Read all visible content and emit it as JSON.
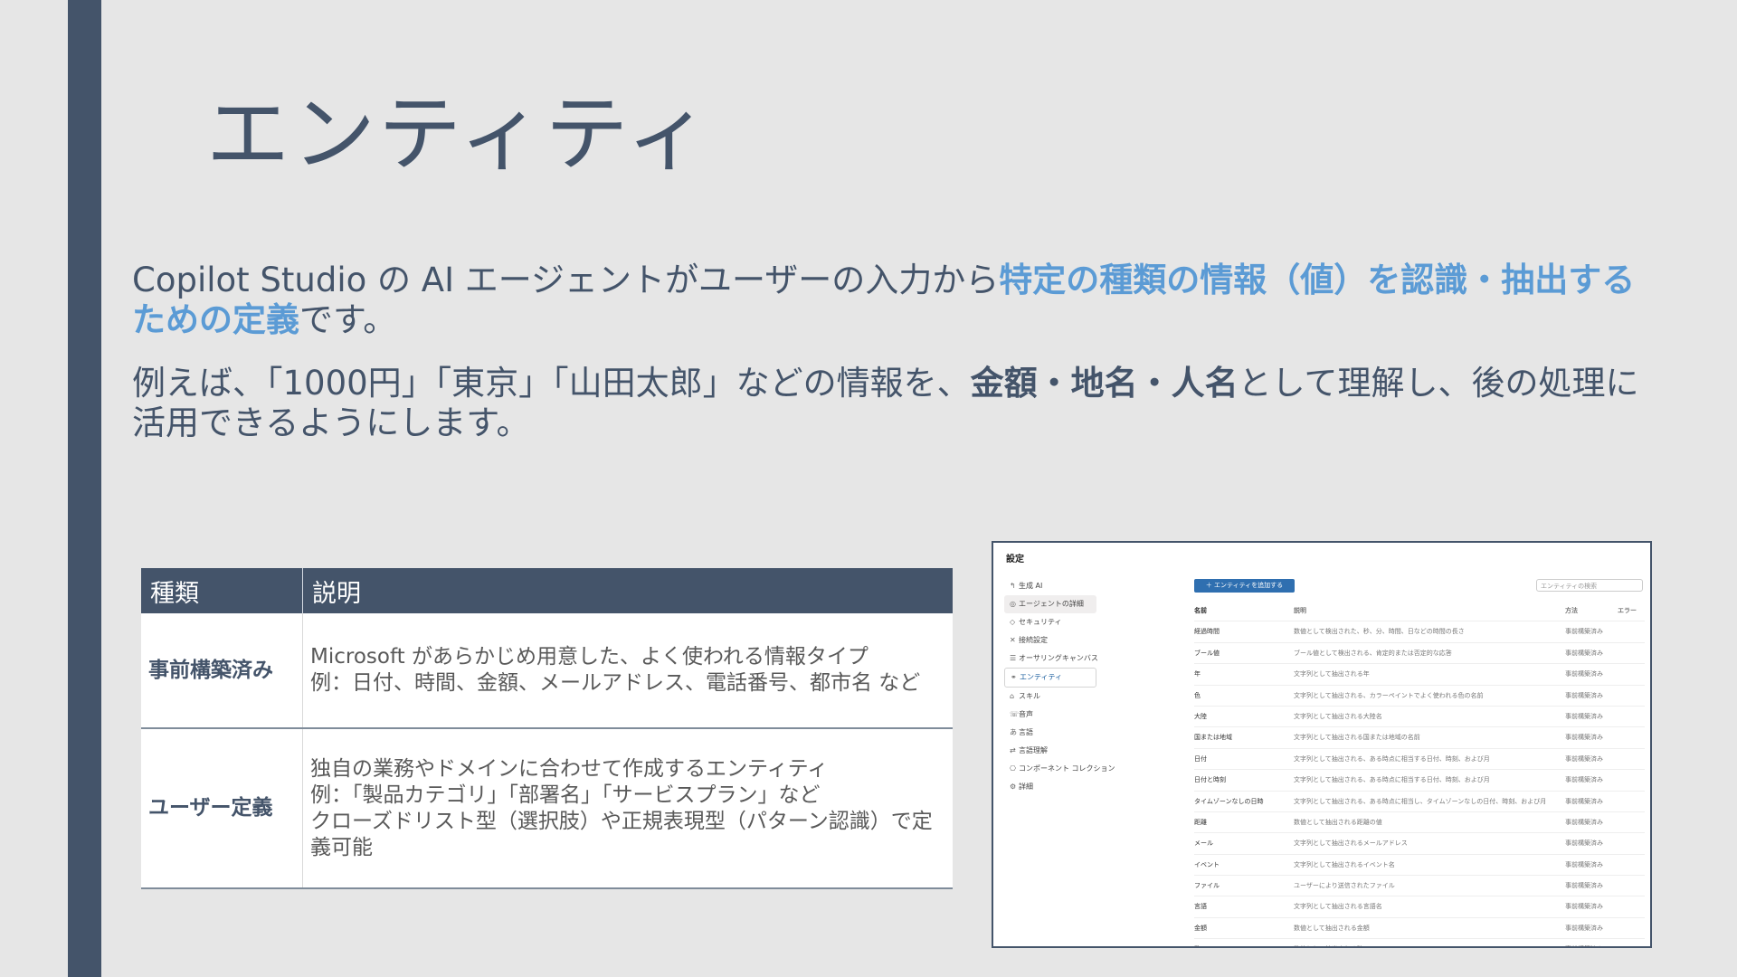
{
  "slide": {
    "title": "エンティティ",
    "para1": {
      "part1": "Copilot Studio の AI エージェントがユーザーの入力から",
      "highlight": "特定の種類の情報（値）を認識・抽出するための定義",
      "part2": "です。"
    },
    "para2": {
      "part1": "例えば、「1000円」「東京」「山田太郎」などの情報を、",
      "bold": "金額・地名・人名",
      "part2": "として理解し、後の処理に活用できるようにします。"
    },
    "table": {
      "headers": [
        "種類",
        "説明"
      ],
      "rows": [
        {
          "name": "事前構築済み",
          "lines": [
            "Microsoft があらかじめ用意した、よく使われる情報タイプ",
            "例：日付、時間、金額、メールアドレス、電話番号、都市名 など"
          ]
        },
        {
          "name": "ユーザー定義",
          "lines": [
            "独自の業務やドメインに合わせて作成するエンティティ",
            "例：「製品カテゴリ」「部署名」「サービスプラン」など",
            "クローズドリスト型（選択肢）や正規表現型（パターン認識）で定義可能"
          ]
        }
      ]
    },
    "colors": {
      "accent": "#44546a",
      "highlight": "#5b9bd5",
      "background": "#e6e6e6"
    }
  },
  "screenshot": {
    "header": "設定",
    "nav": [
      {
        "icon": "back-icon",
        "glyph": "↰",
        "label": "生成 AI"
      },
      {
        "icon": "agent-icon",
        "glyph": "◎",
        "label": "エージェントの詳細"
      },
      {
        "icon": "shield-icon",
        "glyph": "◇",
        "label": "セキュリティ"
      },
      {
        "icon": "connection-icon",
        "glyph": "✕",
        "label": "接続設定"
      },
      {
        "icon": "list-icon",
        "glyph": "☰",
        "label": "オーサリングキャンバス"
      },
      {
        "icon": "entity-icon",
        "glyph": "⚭",
        "label": "エンティティ"
      },
      {
        "icon": "skill-icon",
        "glyph": "⌂",
        "label": "スキル"
      },
      {
        "icon": "voice-icon",
        "glyph": "☏",
        "label": "音声"
      },
      {
        "icon": "language-icon",
        "glyph": "あ",
        "label": "言語"
      },
      {
        "icon": "translate-icon",
        "glyph": "⇄",
        "label": "言語理解"
      },
      {
        "icon": "component-icon",
        "glyph": "⎔",
        "label": "コンポーネント コレクション"
      },
      {
        "icon": "advanced-icon",
        "glyph": "⚙",
        "label": "詳細"
      }
    ],
    "add_button": "＋ エンティティを追加する",
    "search_placeholder": "エンティティの検索",
    "columns": [
      "名前",
      "説明",
      "方法",
      "エラー"
    ],
    "rows": [
      [
        "経過時間",
        "数値として検出された、秒、分、時間、日などの時間の長さ",
        "事前構築済み",
        ""
      ],
      [
        "ブール値",
        "ブール値として検出される、肯定的または否定的な応答",
        "事前構築済み",
        ""
      ],
      [
        "年",
        "文字列として抽出される年",
        "事前構築済み",
        ""
      ],
      [
        "色",
        "文字列として抽出される、カラーペイントでよく使われる色の名前",
        "事前構築済み",
        ""
      ],
      [
        "大陸",
        "文字列として抽出される大陸名",
        "事前構築済み",
        ""
      ],
      [
        "国または地域",
        "文字列として抽出される国または地域の名前",
        "事前構築済み",
        ""
      ],
      [
        "日付",
        "文字列として抽出される、ある時点に相当する日付、時刻、および月",
        "事前構築済み",
        ""
      ],
      [
        "日付と時刻",
        "文字列として抽出される、ある時点に相当する日付、時刻、および月",
        "事前構築済み",
        ""
      ],
      [
        "タイムゾーンなしの日時",
        "文字列として抽出される、ある時点に相当し、タイムゾーンなしの日付、時刻、および月",
        "事前構築済み",
        ""
      ],
      [
        "距離",
        "数値として抽出される距離の値",
        "事前構築済み",
        ""
      ],
      [
        "メール",
        "文字列として抽出されるメールアドレス",
        "事前構築済み",
        ""
      ],
      [
        "イベント",
        "文字列として抽出されるイベント名",
        "事前構築済み",
        ""
      ],
      [
        "ファイル",
        "ユーザーにより送信されたファイル",
        "事前構築済み",
        ""
      ],
      [
        "言語",
        "文字列として抽出される言語名",
        "事前構築済み",
        ""
      ],
      [
        "金額",
        "数値として抽出される金額",
        "事前構築済み",
        ""
      ],
      [
        "数",
        "数値として抽出される数",
        "事前構築済み",
        ""
      ]
    ]
  }
}
